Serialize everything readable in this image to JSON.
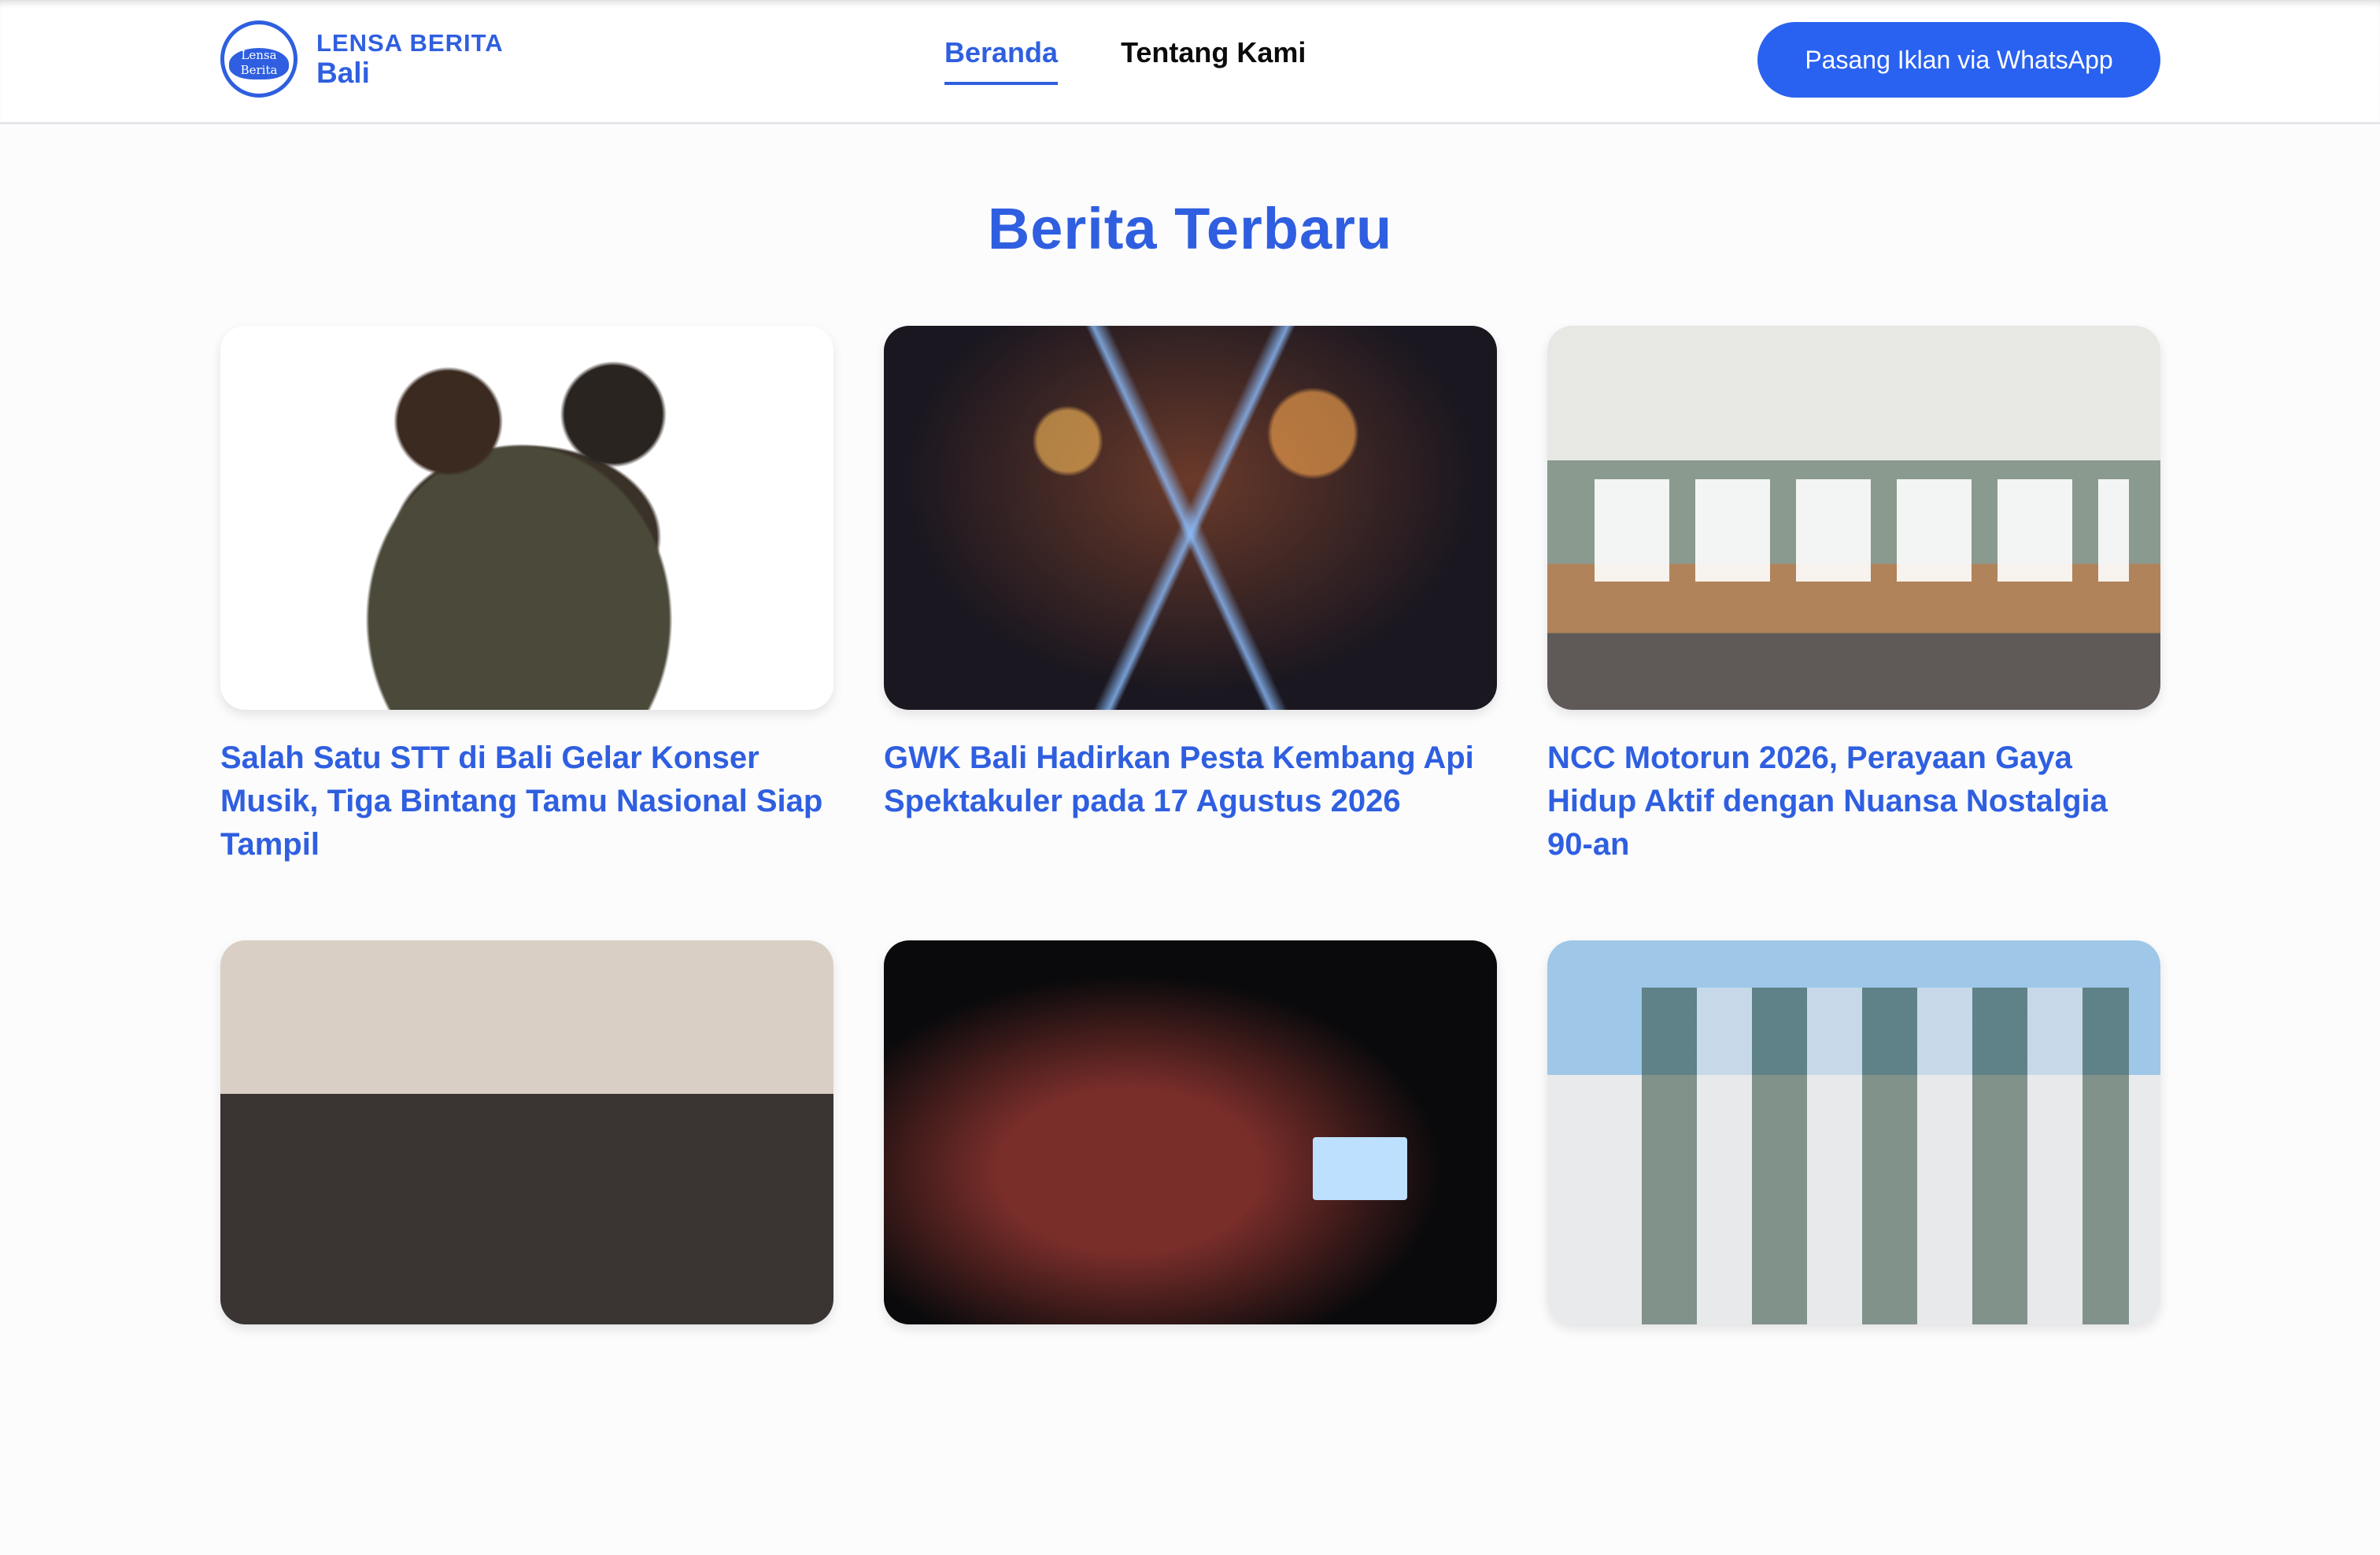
{
  "header": {
    "logo": {
      "line1": "LENSA BERITA",
      "line2": "Bali",
      "badge_line1": "Lensa Berita",
      "badge_line2": "Bali"
    },
    "nav": [
      {
        "label": "Beranda",
        "active": true
      },
      {
        "label": "Tentang Kami",
        "active": false
      }
    ],
    "cta_label": "Pasang Iklan via WhatsApp"
  },
  "main": {
    "section_title": "Berita Terbaru",
    "articles": [
      {
        "title": "Salah Satu STT di Bali Gelar Konser Musik, Tiga Bintang Tamu Nasional Siap Tampil",
        "image": "band-photo"
      },
      {
        "title": "GWK Bali Hadirkan Pesta Kembang Api Spektakuler pada 17 Agustus 2026",
        "image": "fireworks-photo"
      },
      {
        "title": "NCC Motorun 2026, Perayaan Gaya Hidup Aktif dengan Nuansa Nostalgia 90-an",
        "image": "press-event-photo"
      },
      {
        "title": "",
        "image": "group-photo"
      },
      {
        "title": "",
        "image": "dance-performance-photo"
      },
      {
        "title": "",
        "image": "press-conference-photo"
      }
    ]
  },
  "colors": {
    "accent": "#2f5fe0",
    "cta": "#2962f0",
    "nav_text": "#0b0b0b"
  }
}
